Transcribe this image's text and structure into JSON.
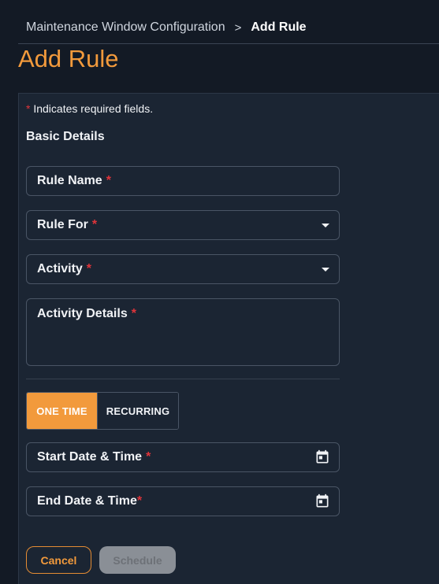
{
  "breadcrumb": {
    "parent": "Maintenance Window Configuration",
    "separator": ">",
    "current": "Add Rule"
  },
  "page_title": "Add Rule",
  "form": {
    "required_star": "*",
    "required_note": "Indicates required fields.",
    "section_title": "Basic Details",
    "fields": {
      "rule_name": {
        "label": "Rule Name",
        "required": "*"
      },
      "rule_for": {
        "label": "Rule For",
        "required": "*"
      },
      "activity": {
        "label": "Activity",
        "required": "*"
      },
      "activity_details": {
        "label": "Activity Details",
        "required": "*"
      },
      "start_datetime": {
        "label": "Start Date & Time",
        "required": "*"
      },
      "end_datetime": {
        "label": "End Date & Time",
        "required": "*"
      }
    },
    "schedule_type": {
      "options": [
        "ONE TIME",
        "RECURRING"
      ],
      "selected": "ONE TIME"
    },
    "buttons": {
      "cancel": "Cancel",
      "schedule": "Schedule"
    }
  },
  "icons": {
    "dropdown": "chevron-down-icon",
    "calendar": "calendar-icon"
  },
  "colors": {
    "accent": "#f29a3c",
    "required": "#e0343a",
    "background": "#131a25",
    "panel": "#1b2533"
  }
}
